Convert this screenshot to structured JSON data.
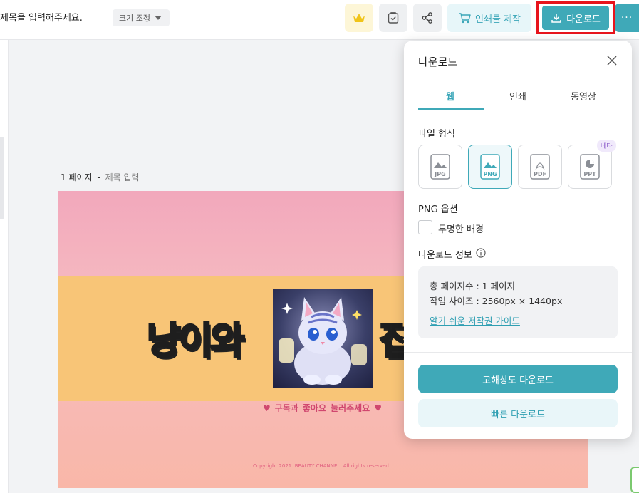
{
  "header": {
    "title_placeholder": "제목을 입력해주세요.",
    "resize_label": "크기 조정",
    "print_label": "인쇄물 제작",
    "download_label": "다운로드",
    "more_label": "···"
  },
  "page": {
    "number_label": "1 페이지",
    "separator": "-",
    "title_placeholder": "제목 입력"
  },
  "canvas": {
    "headline": "냥이와",
    "headline_partial": "집",
    "sub_text_prefix": "구독과",
    "sub_text_bold": "좋아요",
    "sub_text_suffix": "눌러주세요",
    "copyright": "Copyright 2021. BEAUTY CHANNEL. All rights reserved"
  },
  "panel": {
    "title": "다운로드",
    "tabs": [
      {
        "label": "웹",
        "active": true
      },
      {
        "label": "인쇄",
        "active": false
      },
      {
        "label": "동영상",
        "active": false
      }
    ],
    "file_format_label": "파일 형식",
    "formats": [
      {
        "label": "JPG",
        "selected": false
      },
      {
        "label": "PNG",
        "selected": true
      },
      {
        "label": "PDF",
        "selected": false
      },
      {
        "label": "PPT",
        "selected": false
      }
    ],
    "beta_badge": "베타",
    "png_options_label": "PNG 옵션",
    "transparent_bg_label": "투명한 배경",
    "download_info_label": "다운로드 정보",
    "total_pages": "총 페이지수 : 1 페이지",
    "work_size": "작업 사이즈 : 2560px × 1440px",
    "guide_link": "알기 쉬운 저작권 가이드",
    "hq_download_label": "고해상도 다운로드",
    "fast_download_label": "빠른 다운로드"
  },
  "colors": {
    "accent": "#3fa9b8",
    "highlight_border": "#e8141c",
    "crown": "#f0c419",
    "beta": "#8b5cc9"
  }
}
